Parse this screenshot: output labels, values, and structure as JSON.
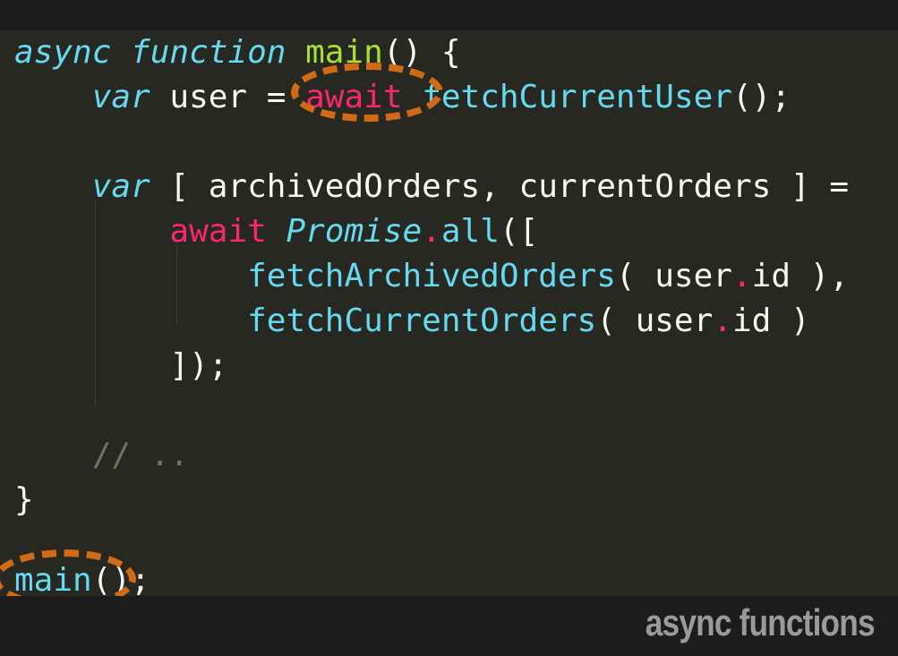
{
  "caption": "async functions",
  "colors": {
    "background": "#272822",
    "keyword": "#f92672",
    "storage": "#66d9ef",
    "function_name": "#a6e22e",
    "comment": "#75715e",
    "highlight": "#d06a14"
  },
  "code": {
    "line1": {
      "kw": "async function",
      "name": "main",
      "rest": "() {"
    },
    "line2": {
      "indent": "    ",
      "kw": "var",
      "mid": " user = ",
      "await": "await",
      "sp": " ",
      "call": "fetchCurrentUser",
      "end": "();"
    },
    "line4": {
      "indent": "    ",
      "kw": "var",
      "rest": " [ archivedOrders, currentOrders ] ="
    },
    "line5": {
      "indent": "        ",
      "await": "await",
      "sp": " ",
      "cls": "Promise",
      "dot": ".",
      "method": "all",
      "end": "(["
    },
    "line6": {
      "indent": "            ",
      "call": "fetchArchivedOrders",
      "open": "( user",
      "dot": ".",
      "close": "id ),"
    },
    "line7": {
      "indent": "            ",
      "call": "fetchCurrentOrders",
      "open": "( user",
      "dot": ".",
      "close": "id )"
    },
    "line8": {
      "indent": "        ",
      "text": "]);"
    },
    "line10": {
      "indent": "    ",
      "comment": "// .."
    },
    "line11": {
      "text": "}"
    },
    "line13": {
      "name": "main",
      "end": "();"
    }
  }
}
